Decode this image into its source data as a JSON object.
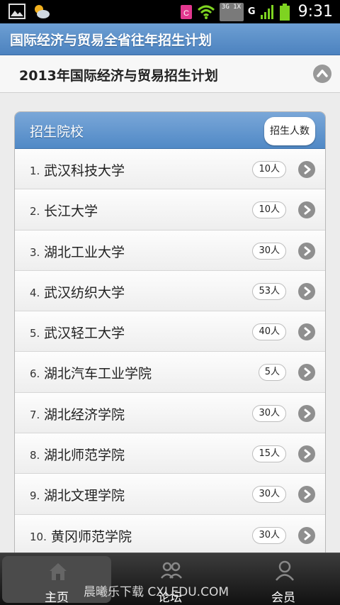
{
  "status_bar": {
    "time": "9:31",
    "network": "3G 1X",
    "carrier_letter": "G",
    "icons": [
      "picture-icon",
      "weather-icon",
      "notification-icon",
      "wifi-icon",
      "signal-icon",
      "battery-icon"
    ]
  },
  "header": {
    "title": "国际经济与贸易全省往年招生计划"
  },
  "collapsible": {
    "title": "2013年国际经济与贸易招生计划"
  },
  "list": {
    "header_title": "招生院校",
    "header_count": "招生人数",
    "items": [
      {
        "num": "1.",
        "name": "武汉科技大学",
        "count": "10人"
      },
      {
        "num": "2.",
        "name": "长江大学",
        "count": "10人"
      },
      {
        "num": "3.",
        "name": "湖北工业大学",
        "count": "30人"
      },
      {
        "num": "4.",
        "name": "武汉纺织大学",
        "count": "53人"
      },
      {
        "num": "5.",
        "name": "武汉轻工大学",
        "count": "40人"
      },
      {
        "num": "6.",
        "name": "湖北汽车工业学院",
        "count": "5人"
      },
      {
        "num": "7.",
        "name": "湖北经济学院",
        "count": "30人"
      },
      {
        "num": "8.",
        "name": "湖北师范学院",
        "count": "15人"
      },
      {
        "num": "9.",
        "name": "湖北文理学院",
        "count": "30人"
      },
      {
        "num": "10.",
        "name": "黄冈师范学院",
        "count": "30人"
      }
    ]
  },
  "nav": {
    "items": [
      {
        "label": "主页",
        "icon": "home-icon"
      },
      {
        "label": "论坛",
        "icon": "forum-icon"
      },
      {
        "label": "会员",
        "icon": "member-icon"
      }
    ]
  },
  "watermark": "晨曦乐下载 CXLEDU.COM",
  "colors": {
    "header_blue": "#5a8fc9",
    "arrow_gray": "#8f8f8f"
  }
}
